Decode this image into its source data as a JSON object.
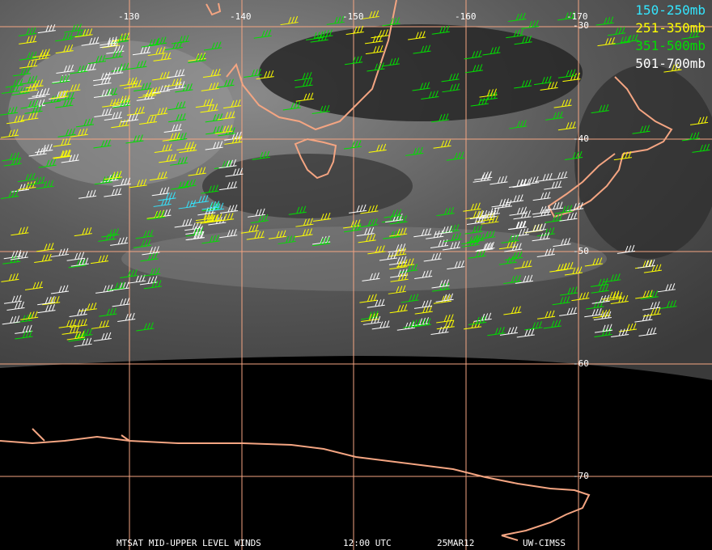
{
  "legend": [
    {
      "label": "150-250mb",
      "color": "#33e6ff"
    },
    {
      "label": "251-350mb",
      "color": "#ffff00"
    },
    {
      "label": "351-500mb",
      "color": "#00e000"
    },
    {
      "label": "501-700mb",
      "color": "#ffffff"
    }
  ],
  "lon_labels": [
    "-130",
    "-140",
    "-150",
    "-160",
    "-170"
  ],
  "lat_labels": [
    "-30",
    "-40",
    "-50",
    "-60",
    "-70"
  ],
  "footer": {
    "title": "MTSAT MID-UPPER LEVEL WINDS",
    "time": "12:00 UTC",
    "date": "25MAR12",
    "source": "UW-CIMSS"
  },
  "colors": {
    "grid": "#f4a582",
    "coast": "#f4a582",
    "background_space": "#000000"
  }
}
